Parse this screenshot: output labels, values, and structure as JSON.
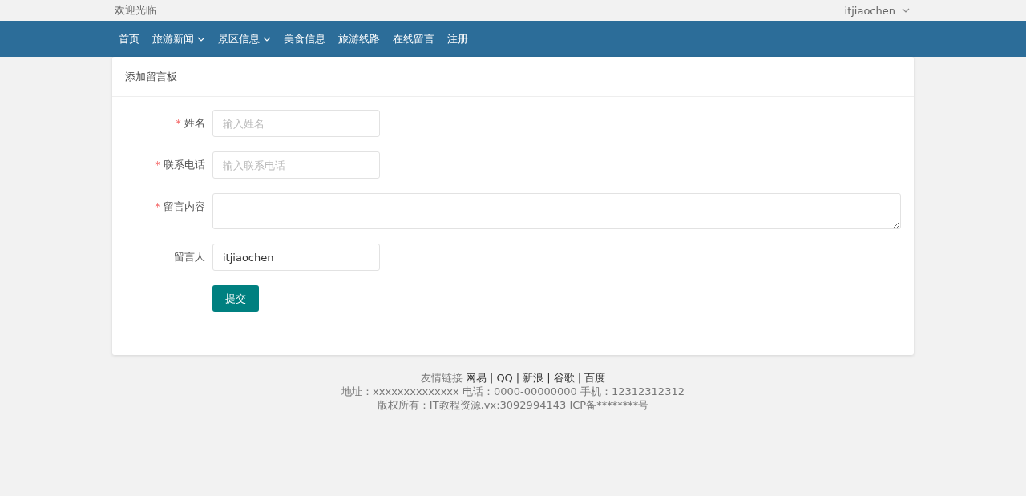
{
  "top_bar": {
    "greeting": "欢迎光临",
    "user": "itjiaochen"
  },
  "nav": [
    {
      "label": "首页",
      "dropdown": false
    },
    {
      "label": "旅游新闻",
      "dropdown": true
    },
    {
      "label": "景区信息",
      "dropdown": true
    },
    {
      "label": "美食信息",
      "dropdown": false
    },
    {
      "label": "旅游线路",
      "dropdown": false
    },
    {
      "label": "在线留言",
      "dropdown": false
    },
    {
      "label": "注册",
      "dropdown": false
    }
  ],
  "card": {
    "title": "添加留言板",
    "fields": [
      {
        "label": "姓名",
        "required": true,
        "kind": "input",
        "placeholder": "输入姓名"
      },
      {
        "label": "联系电话",
        "required": true,
        "kind": "input",
        "placeholder": "输入联系电话"
      },
      {
        "label": "留言内容",
        "required": true,
        "kind": "textarea"
      },
      {
        "label": "留言人",
        "required": false,
        "kind": "input",
        "value": "itjiaochen"
      }
    ],
    "required_mark": "*",
    "submit": "提交"
  },
  "footer": {
    "links_label": "友情链接",
    "separator": "|",
    "links": [
      "网易",
      "QQ",
      "新浪",
      "谷歌",
      "百度"
    ],
    "address_line": "地址：xxxxxxxxxxxxxx 电话：0000-00000000 手机：12312312312",
    "copyright": "版权所有：IT教程资源,vx:3092994143 ICP备********号"
  }
}
